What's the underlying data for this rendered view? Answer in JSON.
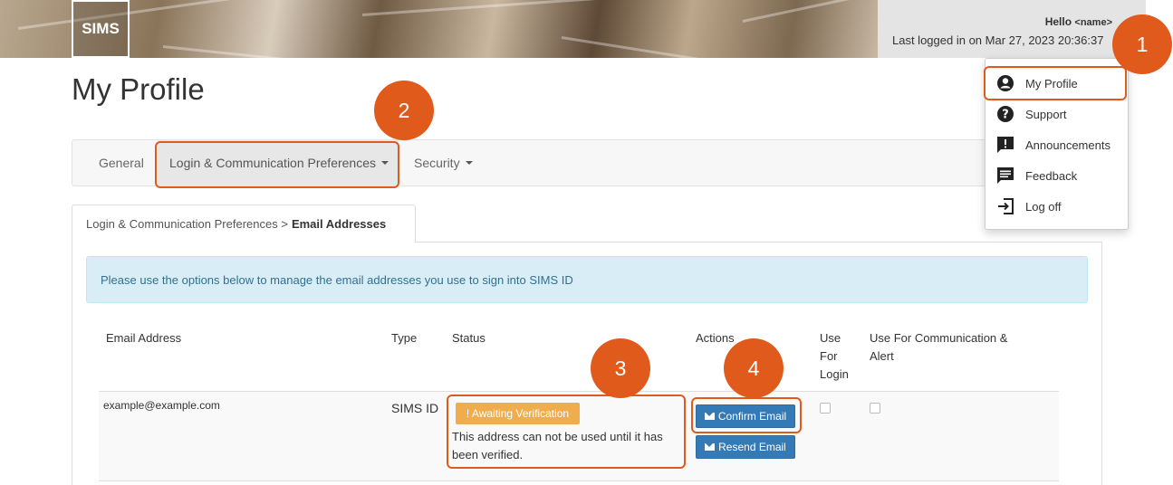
{
  "header": {
    "logo": "SIMS",
    "hello": "Hello",
    "user_name": "<name>",
    "last_logged": "Last logged in on Mar 27, 2023 20:36:37"
  },
  "page_title": "My Profile",
  "nav": {
    "tabs": [
      {
        "label": "General"
      },
      {
        "label": "Login & Communication Preferences"
      },
      {
        "label": "Security"
      }
    ]
  },
  "breadcrumb": {
    "parent": "Login & Communication Preferences >",
    "current": "Email Addresses"
  },
  "info_message": "Please use the options below to manage the email addresses you use to sign into SIMS ID",
  "table": {
    "headers": {
      "email": "Email Address",
      "type": "Type",
      "status": "Status",
      "actions": "Actions",
      "use_login": "Use For Login",
      "use_comm": "Use For Communication & Alert"
    },
    "rows": [
      {
        "email": "example@example.com",
        "type": "SIMS ID",
        "status_badge": "! Awaiting Verification",
        "status_note": "This address can not be used until it has been verified.",
        "confirm_label": "Confirm Email",
        "resend_label": "Resend Email"
      }
    ]
  },
  "dropdown": {
    "items": [
      {
        "label": "My Profile",
        "icon": "user-circle-icon"
      },
      {
        "label": "Support",
        "icon": "question-circle-icon"
      },
      {
        "label": "Announcements",
        "icon": "announcement-icon"
      },
      {
        "label": "Feedback",
        "icon": "feedback-icon"
      },
      {
        "label": "Log off",
        "icon": "logout-icon"
      }
    ]
  },
  "callouts": [
    "1",
    "2",
    "3",
    "4"
  ],
  "colors": {
    "accent": "#e05a1c",
    "primary_button": "#337ab7",
    "warning": "#f0ad4e",
    "info_bg": "#d9edf7",
    "info_text": "#31708f"
  }
}
